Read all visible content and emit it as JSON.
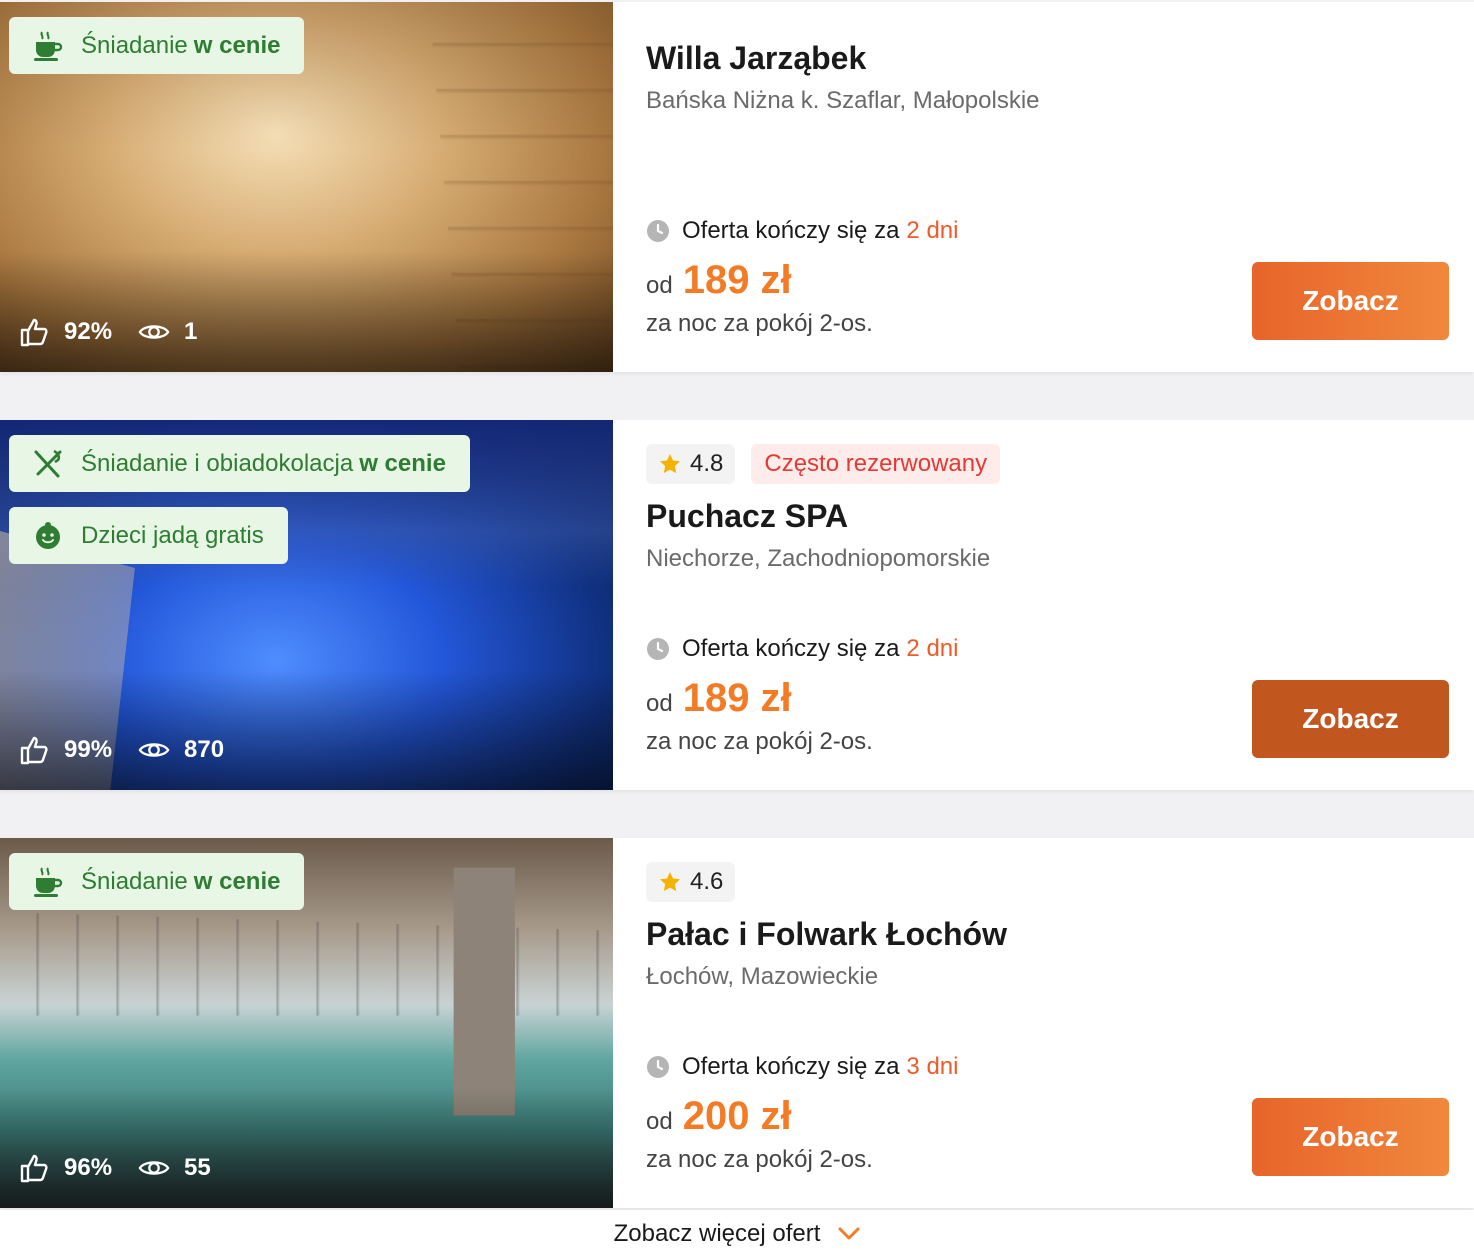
{
  "offers": [
    {
      "badges": [
        {
          "icon": "coffee-cup-icon",
          "text": "Śniadanie",
          "bold": "w cenie"
        }
      ],
      "likes": "92%",
      "views": "1",
      "rating": null,
      "tag": null,
      "title": "Willa Jarząbek",
      "location": "Bańska Niżna k. Szaflar, Małopolskie",
      "offer_text": "Oferta kończy się za",
      "offer_days": "2 dni",
      "price_from": "od",
      "price": "189 zł",
      "per": "za noc za pokój 2-os.",
      "button": "Zobacz"
    },
    {
      "badges": [
        {
          "icon": "fork-knife-icon",
          "text": "Śniadanie i obiadokolacja",
          "bold": "w cenie"
        },
        {
          "icon": "child-face-icon",
          "text": "Dzieci jadą gratis",
          "bold": ""
        }
      ],
      "likes": "99%",
      "views": "870",
      "rating": "4.8",
      "tag": "Często rezerwowany",
      "title": "Puchacz SPA",
      "location": "Niechorze, Zachodniopomorskie",
      "offer_text": "Oferta kończy się za",
      "offer_days": "2 dni",
      "price_from": "od",
      "price": "189 zł",
      "per": "za noc za pokój 2-os.",
      "button": "Zobacz"
    },
    {
      "badges": [
        {
          "icon": "coffee-cup-icon",
          "text": "Śniadanie",
          "bold": "w cenie"
        }
      ],
      "likes": "96%",
      "views": "55",
      "rating": "4.6",
      "tag": null,
      "title": "Pałac i Folwark Łochów",
      "location": "Łochów, Mazowieckie",
      "offer_text": "Oferta kończy się za",
      "offer_days": "3 dni",
      "price_from": "od",
      "price": "200 zł",
      "per": "za noc za pokój 2-os.",
      "button": "Zobacz"
    }
  ],
  "more_label": "Zobacz więcej ofert",
  "colors": {
    "accent": "#f47b25",
    "button": "#e8642a",
    "badge_bg": "#e8f6e6",
    "badge_text": "#2e7d32",
    "days": "#f05a28"
  }
}
